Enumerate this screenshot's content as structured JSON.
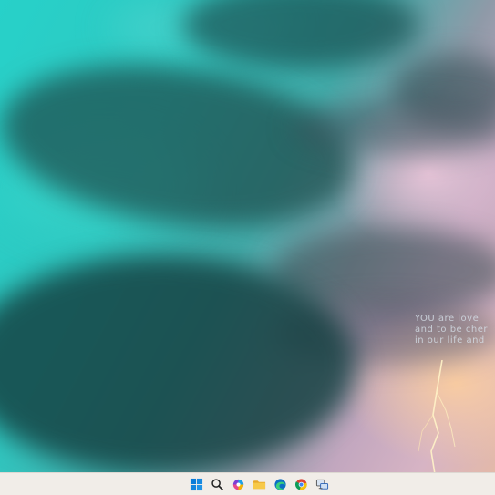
{
  "wallpaper": {
    "quote_lines": [
      "YOU are love",
      "and to be cher",
      "in our life and"
    ],
    "colors": {
      "sky": "#2fc8c1",
      "storm": "#1c4848",
      "glow": "#e3b9a9"
    }
  },
  "taskbar": {
    "items": [
      {
        "name": "start",
        "icon": "windows-logo-icon"
      },
      {
        "name": "search",
        "icon": "search-icon"
      },
      {
        "name": "widgets",
        "icon": "colorful-widgets-icon"
      },
      {
        "name": "file-explorer",
        "icon": "folder-icon"
      },
      {
        "name": "edge",
        "icon": "edge-browser-icon"
      },
      {
        "name": "chrome",
        "icon": "chrome-browser-icon"
      },
      {
        "name": "remote-desktop",
        "icon": "remote-desktop-icon"
      }
    ],
    "colors": {
      "background": "#f1ede8",
      "accent": "#0078d4"
    }
  }
}
